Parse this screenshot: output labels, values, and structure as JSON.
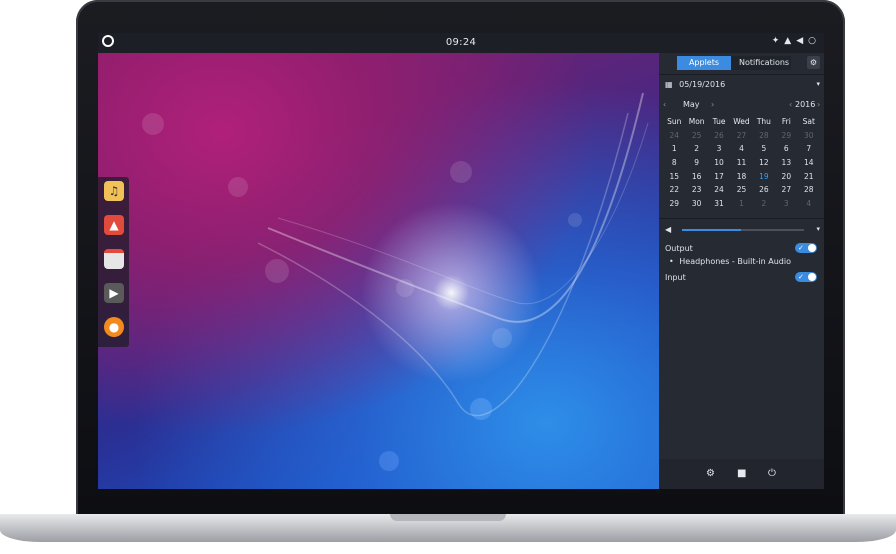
{
  "topbar": {
    "clock": "09:24",
    "menu_icon": "circle-menu-icon",
    "tray_icons": [
      "network-icon",
      "bell-icon",
      "volume-icon",
      "power-icon"
    ]
  },
  "dock": {
    "apps": [
      {
        "name": "music",
        "icon": "music-note-icon",
        "color": "#f2c25a"
      },
      {
        "name": "photos",
        "icon": "photo-icon",
        "color": "#e24b3b"
      },
      {
        "name": "calendar",
        "icon": "calendar-icon",
        "color": "#e6e6e6"
      },
      {
        "name": "videos",
        "icon": "play-icon",
        "color": "#5a5a5a"
      },
      {
        "name": "firefox",
        "icon": "firefox-icon",
        "color": "#f28a1e"
      }
    ]
  },
  "panel": {
    "tabs": {
      "applets": "Applets",
      "notifications": "Notifications"
    },
    "date": "05/19/2016",
    "calendar": {
      "month": "May",
      "year": "2016",
      "weekdays": [
        "Sun",
        "Mon",
        "Tue",
        "Wed",
        "Thu",
        "Fri",
        "Sat"
      ],
      "weeks": [
        [
          "24",
          "25",
          "26",
          "27",
          "28",
          "29",
          "30"
        ],
        [
          "1",
          "2",
          "3",
          "4",
          "5",
          "6",
          "7"
        ],
        [
          "8",
          "9",
          "10",
          "11",
          "12",
          "13",
          "14"
        ],
        [
          "15",
          "16",
          "17",
          "18",
          "19",
          "20",
          "21"
        ],
        [
          "22",
          "23",
          "24",
          "25",
          "26",
          "27",
          "28"
        ],
        [
          "29",
          "30",
          "31",
          "1",
          "2",
          "3",
          "4"
        ]
      ],
      "today": "19"
    },
    "sound": {
      "volume_level": 0.48,
      "output_label": "Output",
      "output_device": "Headphones - Built-in Audio",
      "input_label": "Input",
      "output_enabled": true,
      "input_enabled": true
    },
    "footer_icons": [
      "settings-icon",
      "lock-icon",
      "power-icon"
    ]
  },
  "colors": {
    "accent": "#3b8be0",
    "panel_bg": "#262a33",
    "topbar_bg": "#1d1f26"
  }
}
